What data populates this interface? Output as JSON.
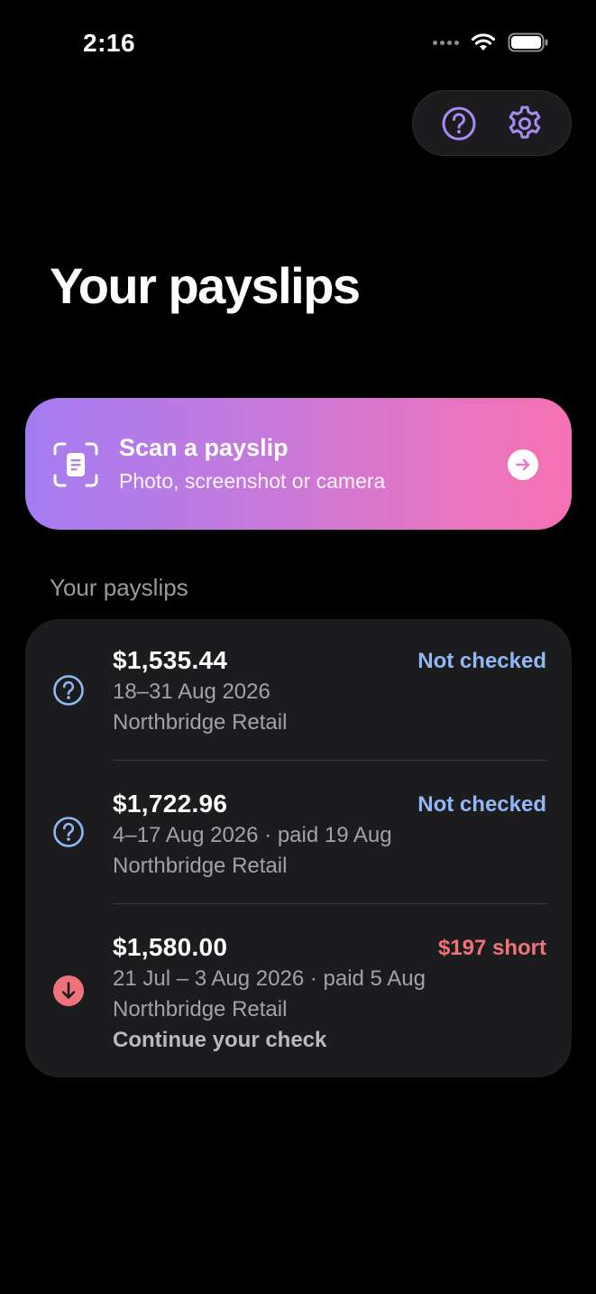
{
  "status_bar": {
    "time": "2:16"
  },
  "top_actions": {
    "help_icon": "help-circle-icon",
    "settings_icon": "gear-icon"
  },
  "page": {
    "title": "Your payslips"
  },
  "scan_card": {
    "title": "Scan a payslip",
    "subtitle": "Photo, screenshot or camera",
    "icon": "document-scan-icon",
    "arrow_icon": "arrow-right-icon"
  },
  "section": {
    "header": "Your payslips"
  },
  "payslips": [
    {
      "amount": "$1,535.44",
      "status": "Not checked",
      "period": "18–31 Aug 2026",
      "employer": "Northbridge Retail",
      "icon": "question-circle-icon"
    },
    {
      "amount": "$1,722.96",
      "status": "Not checked",
      "period": "4–17 Aug 2026 · paid 19 Aug",
      "employer": "Northbridge Retail",
      "icon": "question-circle-icon"
    },
    {
      "amount": "$1,580.00",
      "status": "$197 short",
      "period": "21 Jul – 3 Aug 2026 · paid 5 Aug",
      "employer": "Northbridge Retail",
      "cta": "Continue your check",
      "icon": "arrow-down-circle-icon"
    }
  ],
  "colors": {
    "accent_purple": "#a88af5",
    "status_blue": "#8fb8f4",
    "status_red": "#f0727a",
    "card_bg": "#1c1c1e"
  }
}
